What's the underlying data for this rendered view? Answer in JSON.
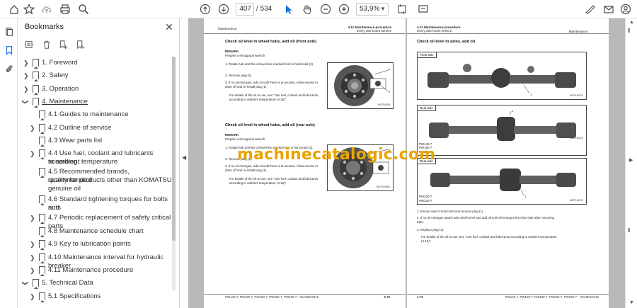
{
  "toolbar": {
    "current_page": "407",
    "page_separator": "/",
    "total_pages": "534",
    "zoom": "53,9%",
    "icons": [
      "star-icon",
      "cloud-upload-icon",
      "print-icon",
      "search-icon",
      "page-up-icon",
      "page-down-icon",
      "select-cursor-icon",
      "hand-icon",
      "zoom-out-icon",
      "zoom-in-icon",
      "fit-page-icon",
      "sign-icon",
      "email-icon",
      "account-icon"
    ]
  },
  "bookmarks_panel": {
    "title": "Bookmarks",
    "items": [
      {
        "label": "1. Foreword",
        "level": 0,
        "expandable": true,
        "expanded": false
      },
      {
        "label": "2. Safety",
        "level": 0,
        "expandable": true,
        "expanded": false
      },
      {
        "label": "3. Operation",
        "level": 0,
        "expandable": true,
        "expanded": false
      },
      {
        "label": "4. Maintenance",
        "level": 0,
        "expandable": true,
        "expanded": true,
        "current": true
      },
      {
        "label": "4.1 Guides to maintenance",
        "level": 1,
        "expandable": false
      },
      {
        "label": "4.2 Outline of service",
        "level": 1,
        "expandable": true
      },
      {
        "label": "4.3 Wear parts list",
        "level": 1,
        "expandable": false
      },
      {
        "label": "4.4 Use fuel, coolant and lubricants according",
        "label2": "to ambient temperature",
        "level": 1,
        "expandable": true
      },
      {
        "label": "4.5 Recommended brands, recommended",
        "label2": "quality for products other than KOMATSU",
        "label3": "genuine oil",
        "level": 1,
        "expandable": false
      },
      {
        "label": "4.6 Standard tightening torques for bolts and",
        "label2": "nuts",
        "level": 1,
        "expandable": false
      },
      {
        "label": "4.7 Periodic replacement of safety critical parts",
        "level": 1,
        "expandable": true
      },
      {
        "label": "4.8 Maintenance schedule chart",
        "level": 1,
        "expandable": false
      },
      {
        "label": "4.9 Key to lubrication points",
        "level": 1,
        "expandable": true
      },
      {
        "label": "4.10 Maintenance interval for hydraulic breaker",
        "level": 1,
        "expandable": true
      },
      {
        "label": "4.11 Maintenance procedure",
        "level": 1,
        "expandable": true
      },
      {
        "label": "5. Technical Data",
        "level": 0,
        "expandable": true,
        "expanded": true
      },
      {
        "label": "5.1 Specifications",
        "level": 1,
        "expandable": true
      }
    ]
  },
  "left_page": {
    "header_left": "Maintenance",
    "header_right_1": "4.11 Maintenance procedure",
    "header_right_2": "Every 250 hours service",
    "section1_title": "Check oil level in wheel hubs, add oil (front axle)",
    "section1_remark": "REMARK",
    "section1_remark_text": "Prepare a hexagonal wrench",
    "section1_steps": [
      "1.  Rotate hub until the oil level line marked front is horizontal (2).",
      "2.  Remove plug (1).",
      "3.  If no oil emerges, add oil until there is an excess. Allow excess to drain off and re-install plug (1).",
      "For details of the oil to use, see \"Use fuel, coolant and lubricants according to ambient temperature (4-16)\"."
    ],
    "fig1_code": "MCP1N0B",
    "section2_title": "Check oil level in wheel hubs, add oil (rear axle)",
    "section2_remark": "REMARK",
    "section2_remark_text": "Prepare a hexagonal wrench",
    "section2_steps": [
      "1.  Rotate hub until the oil level line marked rear is horizontal (2).",
      "2.  Remove plug (1).",
      "3.  If no oil emerges, add oil until there is an excess. Allow excess to drain off and re-install plug (1).",
      "For details of the oil to use, see \"Use fuel, coolant and lubricants according to ambient temperature (4-16)\"."
    ],
    "fig2_code": "MCP1N0B1",
    "footer_left": "PW140-7, PW160-7, PW180-7, PW200-7, PW220-7 - VEAM010410",
    "footer_right": "4-75"
  },
  "right_page": {
    "header_left_1": "4.11 Maintenance procedure",
    "header_left_2": "Every 250 hours service",
    "header_right": "Maintenance",
    "title": "Check oil level in axles, add oil",
    "fig_front_label": "Front axle",
    "fig_front_code": "MCP1N0C0",
    "fig_rear1_label": "Rear axle",
    "fig_rear1_models": [
      "PW140-7",
      "PW160-7",
      "PW180-7"
    ],
    "fig_rear1_code": "MCP1N0C0",
    "fig_rear2_label": "Rear axle",
    "fig_rear2_models": [
      "PW200-7",
      "PW220-7"
    ],
    "fig_rear2_code": "MCP1N0C2",
    "steps": [
      "1.  Ensure axle is horizontal and remove plug (1).",
      "2.  If no oil emerges attach tube and funnel and add oil until oil emerges from the hole after removing tube.",
      "3.  Replace plug (1).",
      "For details of the oil to use, see \"Use fuel, coolant and lubricants according to ambient temperature (4-16)\"."
    ],
    "footer_left": "4-76",
    "footer_right": "PW140-7, PW160-7, PW180-7, PW200-7, PW220-7 - VEAM010410"
  },
  "watermark": "machinecatalogic.com"
}
